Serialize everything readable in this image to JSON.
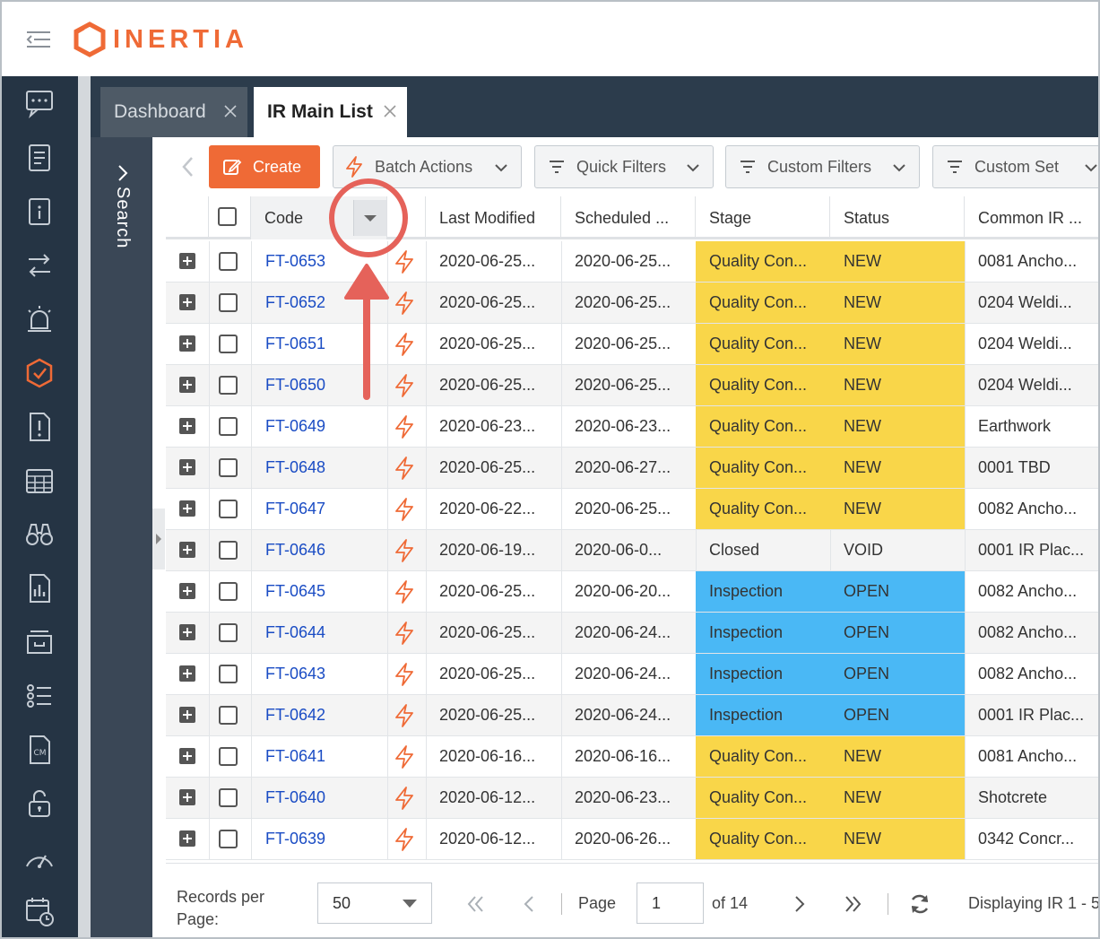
{
  "app": {
    "logo_text": "INERTIA",
    "brand_color": "#ef6a36"
  },
  "tabs": [
    {
      "label": "Dashboard",
      "active": false
    },
    {
      "label": "IR Main List",
      "active": true
    }
  ],
  "search_panel": {
    "label": "Search"
  },
  "toolbar": {
    "create": "Create",
    "batch_actions": "Batch Actions",
    "quick_filters": "Quick Filters",
    "custom_filters": "Custom Filters",
    "custom_set": "Custom Set"
  },
  "columns": {
    "code": "Code",
    "last_modified": "Last Modified",
    "scheduled": "Scheduled ...",
    "stage": "Stage",
    "status": "Status",
    "common_ir": "Common IR ..."
  },
  "stage_colors": {
    "Quality Con...": "#f9d649",
    "Inspection": "#4ab8f5",
    "Closed": "transparent"
  },
  "rows": [
    {
      "code": "FT-0653",
      "last_modified": "2020-06-25...",
      "scheduled": "2020-06-25...",
      "stage": "Quality Con...",
      "status": "NEW",
      "common_ir": "0081 Ancho..."
    },
    {
      "code": "FT-0652",
      "last_modified": "2020-06-25...",
      "scheduled": "2020-06-25...",
      "stage": "Quality Con...",
      "status": "NEW",
      "common_ir": "0204 Weldi..."
    },
    {
      "code": "FT-0651",
      "last_modified": "2020-06-25...",
      "scheduled": "2020-06-25...",
      "stage": "Quality Con...",
      "status": "NEW",
      "common_ir": "0204 Weldi..."
    },
    {
      "code": "FT-0650",
      "last_modified": "2020-06-25...",
      "scheduled": "2020-06-25...",
      "stage": "Quality Con...",
      "status": "NEW",
      "common_ir": "0204 Weldi..."
    },
    {
      "code": "FT-0649",
      "last_modified": "2020-06-23...",
      "scheduled": "2020-06-23...",
      "stage": "Quality Con...",
      "status": "NEW",
      "common_ir": "Earthwork"
    },
    {
      "code": "FT-0648",
      "last_modified": "2020-06-25...",
      "scheduled": "2020-06-27...",
      "stage": "Quality Con...",
      "status": "NEW",
      "common_ir": "0001 TBD"
    },
    {
      "code": "FT-0647",
      "last_modified": "2020-06-22...",
      "scheduled": "2020-06-25...",
      "stage": "Quality Con...",
      "status": "NEW",
      "common_ir": "0082 Ancho..."
    },
    {
      "code": "FT-0646",
      "last_modified": "2020-06-19...",
      "scheduled": "2020-06-0...",
      "stage": "Closed",
      "status": "VOID",
      "common_ir": "0001 IR Plac..."
    },
    {
      "code": "FT-0645",
      "last_modified": "2020-06-25...",
      "scheduled": "2020-06-20...",
      "stage": "Inspection",
      "status": "OPEN",
      "common_ir": "0082 Ancho..."
    },
    {
      "code": "FT-0644",
      "last_modified": "2020-06-25...",
      "scheduled": "2020-06-24...",
      "stage": "Inspection",
      "status": "OPEN",
      "common_ir": "0082 Ancho..."
    },
    {
      "code": "FT-0643",
      "last_modified": "2020-06-25...",
      "scheduled": "2020-06-24...",
      "stage": "Inspection",
      "status": "OPEN",
      "common_ir": "0082 Ancho..."
    },
    {
      "code": "FT-0642",
      "last_modified": "2020-06-25...",
      "scheduled": "2020-06-24...",
      "stage": "Inspection",
      "status": "OPEN",
      "common_ir": "0001 IR Plac..."
    },
    {
      "code": "FT-0641",
      "last_modified": "2020-06-16...",
      "scheduled": "2020-06-16...",
      "stage": "Quality Con...",
      "status": "NEW",
      "common_ir": "0081 Ancho..."
    },
    {
      "code": "FT-0640",
      "last_modified": "2020-06-12...",
      "scheduled": "2020-06-23...",
      "stage": "Quality Con...",
      "status": "NEW",
      "common_ir": "Shotcrete"
    },
    {
      "code": "FT-0639",
      "last_modified": "2020-06-12...",
      "scheduled": "2020-06-26...",
      "stage": "Quality Con...",
      "status": "NEW",
      "common_ir": "0342 Concr..."
    }
  ],
  "pager": {
    "records_label": "Records per Page:",
    "records_value": "50",
    "page_label": "Page",
    "page_value": "1",
    "page_of": "of 14",
    "displaying": "Displaying IR 1 - 5"
  }
}
